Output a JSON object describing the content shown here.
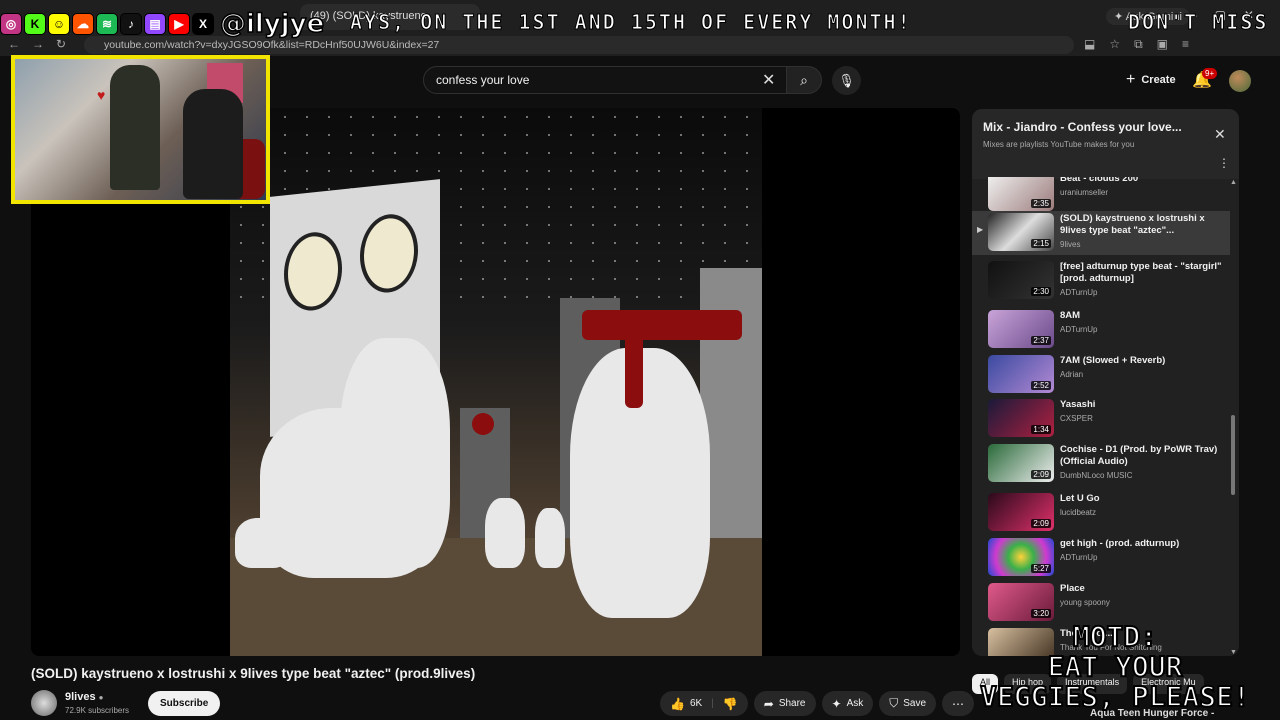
{
  "browser": {
    "tab_title": "(49) (SOLD) kaystrueno",
    "ask_gemini": "Ask Gemini",
    "url": "youtube.com/watch?v=dxyJGSO9Ofk&list=RDcHnf50UJW6U&index=27"
  },
  "overlay": {
    "handle": "@ilyjye",
    "ticker_main": "AYS, ON THE 1ST AND 15TH OF EVERY MONTH!",
    "ticker_right": "DON'T MISS O",
    "motd_line1": "MOTD:",
    "motd_line2": "EAT YOUR",
    "motd_line3": "VEGGIES, PLEASE!"
  },
  "youtube": {
    "search_value": "confess your love",
    "create_label": "Create",
    "notification_count": "9+"
  },
  "playlist": {
    "title": "Mix - Jiandro - Confess your love...",
    "subtitle": "Mixes are playlists YouTube makes for you",
    "items": [
      {
        "title": "Beat - clouds 200",
        "channel": "uraniumseller",
        "duration": "2:35"
      },
      {
        "title": "(SOLD) kaystrueno x lostrushi x 9lives type beat \"aztec\"...",
        "channel": "9lives",
        "duration": "2:15"
      },
      {
        "title": "[free] adturnup type beat - \"stargirl\" [prod. adturnup]",
        "channel": "ADTurnUp",
        "duration": "2:30"
      },
      {
        "title": "8AM",
        "channel": "ADTurnUp",
        "duration": "2:37"
      },
      {
        "title": "7AM (Slowed + Reverb)",
        "channel": "Adrian",
        "duration": "2:52"
      },
      {
        "title": "Yasashi",
        "channel": "CXSPER",
        "duration": "1:34"
      },
      {
        "title": "Cochise - D1 (Prod. by PoWR Trav) (Official Audio)",
        "channel": "DumbNLoco MUSIC",
        "duration": "2:09"
      },
      {
        "title": "Let U Go",
        "channel": "lucidbeatz",
        "duration": "2:09"
      },
      {
        "title": "get high - (prod. adturnup)",
        "channel": "ADTurnUp",
        "duration": "5:27"
      },
      {
        "title": "Place",
        "channel": "young spoony",
        "duration": "3:20"
      },
      {
        "title": "The ... So ...",
        "channel": "Thank You For Not Snitching",
        "duration": ""
      }
    ]
  },
  "chips": [
    "All",
    "Hip hop",
    "Instrumentals",
    "Electronic Mu"
  ],
  "next_up": "Aqua Teen Hunger Force -",
  "video": {
    "title": "(SOLD) kaystrueno x lostrushi x 9lives type beat \"aztec\" (prod.9lives)",
    "channel": "9lives",
    "subscribers": "72.9K subscribers",
    "subscribe_label": "Subscribe",
    "likes": "6K",
    "share_label": "Share",
    "ask_label": "Ask",
    "save_label": "Save"
  },
  "colors": {
    "background": "#0f0f0f",
    "webcam_border": "#f2e600",
    "notification_badge": "#cc0000"
  }
}
